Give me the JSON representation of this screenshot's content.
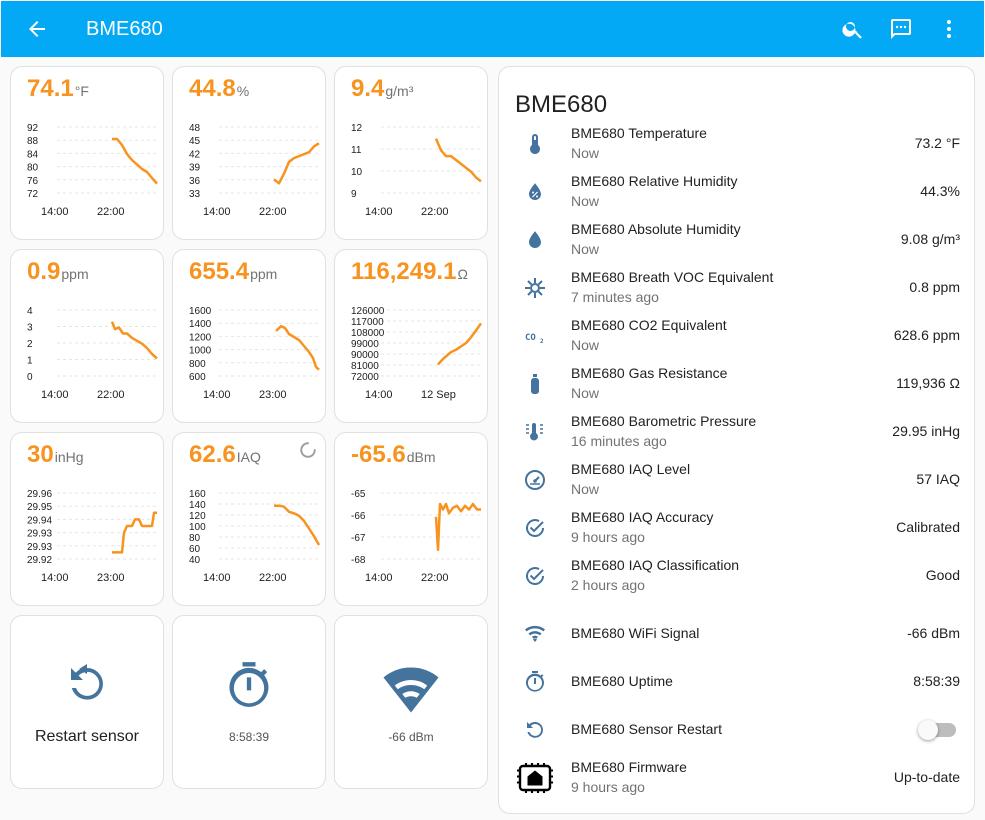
{
  "header": {
    "title": "BME680"
  },
  "colors": {
    "accent": "#f7931e",
    "primary": "#03a9f4",
    "icon": "#44739e"
  },
  "sensor_cards": [
    {
      "value": "74.1",
      "unit": "°F",
      "chart_data": {
        "type": "line",
        "yticks": [
          "92",
          "88",
          "84",
          "80",
          "76",
          "72"
        ],
        "xticks": [
          "14:00",
          "22:00"
        ],
        "ylim": [
          71,
          93
        ],
        "points": [
          [
            0.55,
            89
          ],
          [
            0.6,
            89
          ],
          [
            0.65,
            87
          ],
          [
            0.7,
            84
          ],
          [
            0.75,
            82
          ],
          [
            0.8,
            80.5
          ],
          [
            0.85,
            79
          ],
          [
            0.9,
            78
          ],
          [
            0.95,
            76
          ],
          [
            1.0,
            74.1
          ]
        ]
      }
    },
    {
      "value": "44.8",
      "unit": "%",
      "chart_data": {
        "type": "line",
        "yticks": [
          "48",
          "45",
          "42",
          "39",
          "36",
          "33"
        ],
        "xticks": [
          "14:00",
          "22:00"
        ],
        "ylim": [
          32,
          49
        ],
        "points": [
          [
            0.55,
            35.5
          ],
          [
            0.6,
            34.5
          ],
          [
            0.65,
            37
          ],
          [
            0.7,
            40
          ],
          [
            0.75,
            41
          ],
          [
            0.8,
            41.5
          ],
          [
            0.85,
            42
          ],
          [
            0.9,
            42.5
          ],
          [
            0.95,
            44
          ],
          [
            1.0,
            44.8
          ]
        ]
      }
    },
    {
      "value": "9.4",
      "unit": "g/m³",
      "chart_data": {
        "type": "line",
        "yticks": [
          "12",
          "11",
          "10",
          "9"
        ],
        "xticks": [
          "14:00",
          "22:00"
        ],
        "ylim": [
          8.8,
          12.2
        ],
        "points": [
          [
            0.55,
            11.6
          ],
          [
            0.6,
            11.0
          ],
          [
            0.65,
            10.7
          ],
          [
            0.7,
            10.7
          ],
          [
            0.75,
            10.5
          ],
          [
            0.8,
            10.3
          ],
          [
            0.85,
            10.1
          ],
          [
            0.9,
            9.9
          ],
          [
            0.95,
            9.6
          ],
          [
            1.0,
            9.4
          ]
        ]
      }
    },
    {
      "value": "0.9",
      "unit": "ppm",
      "chart_data": {
        "type": "line",
        "yticks": [
          "4",
          "3",
          "2",
          "1",
          "0"
        ],
        "xticks": [
          "14:00",
          "22:00"
        ],
        "ylim": [
          -0.3,
          4.2
        ],
        "points": [
          [
            0.55,
            3.4
          ],
          [
            0.58,
            2.9
          ],
          [
            0.62,
            3.0
          ],
          [
            0.66,
            2.6
          ],
          [
            0.7,
            2.6
          ],
          [
            0.75,
            2.3
          ],
          [
            0.8,
            2.1
          ],
          [
            0.85,
            1.9
          ],
          [
            0.9,
            1.6
          ],
          [
            0.95,
            1.2
          ],
          [
            1.0,
            0.9
          ]
        ]
      }
    },
    {
      "value": "655.4",
      "unit": "ppm",
      "chart_data": {
        "type": "line",
        "yticks": [
          "1600",
          "1400",
          "1200",
          "1000",
          "800",
          "600"
        ],
        "xticks": [
          "14:00",
          "23:00"
        ],
        "ylim": [
          550,
          1650
        ],
        "points": [
          [
            0.57,
            1300
          ],
          [
            0.62,
            1380
          ],
          [
            0.66,
            1350
          ],
          [
            0.7,
            1250
          ],
          [
            0.75,
            1200
          ],
          [
            0.8,
            1150
          ],
          [
            0.85,
            1050
          ],
          [
            0.9,
            950
          ],
          [
            0.94,
            850
          ],
          [
            0.97,
            700
          ],
          [
            1.0,
            655
          ]
        ]
      }
    },
    {
      "value": "116,249.1",
      "unit": "Ω",
      "chart_data": {
        "type": "line",
        "yticks": [
          "126000",
          "117000",
          "108000",
          "99000",
          "90000",
          "81000",
          "72000"
        ],
        "xticks": [
          "14:00",
          "12 Sep"
        ],
        "ylim": [
          70000,
          128000
        ],
        "points": [
          [
            0.57,
            80000
          ],
          [
            0.62,
            85000
          ],
          [
            0.66,
            88000
          ],
          [
            0.7,
            91000
          ],
          [
            0.75,
            93000
          ],
          [
            0.8,
            96000
          ],
          [
            0.85,
            99000
          ],
          [
            0.9,
            104000
          ],
          [
            0.95,
            110000
          ],
          [
            1.0,
            116249
          ]
        ]
      }
    },
    {
      "value": "30",
      "unit": "inHg",
      "chart_data": {
        "type": "line",
        "yticks": [
          "29.96",
          "29.95",
          "29.94",
          "29.93",
          "29.93",
          "29.92"
        ],
        "xticks": [
          "14:00",
          "23:00"
        ],
        "ylim": [
          29.915,
          29.965
        ],
        "points": [
          [
            0.55,
            29.92
          ],
          [
            0.6,
            29.92
          ],
          [
            0.65,
            29.92
          ],
          [
            0.67,
            29.935
          ],
          [
            0.7,
            29.94
          ],
          [
            0.75,
            29.94
          ],
          [
            0.78,
            29.945
          ],
          [
            0.82,
            29.945
          ],
          [
            0.85,
            29.94
          ],
          [
            0.9,
            29.94
          ],
          [
            0.95,
            29.94
          ],
          [
            0.97,
            29.95
          ],
          [
            1.0,
            29.95
          ]
        ]
      }
    },
    {
      "value": "62.6",
      "unit": "IAQ",
      "spinner": true,
      "chart_data": {
        "type": "line",
        "yticks": [
          "160",
          "140",
          "120",
          "100",
          "80",
          "60",
          "40"
        ],
        "xticks": [
          "14:00",
          "22:00"
        ],
        "ylim": [
          35,
          165
        ],
        "points": [
          [
            0.55,
            140
          ],
          [
            0.6,
            140
          ],
          [
            0.65,
            138
          ],
          [
            0.7,
            128
          ],
          [
            0.75,
            125
          ],
          [
            0.8,
            120
          ],
          [
            0.85,
            110
          ],
          [
            0.9,
            95
          ],
          [
            0.95,
            80
          ],
          [
            1.0,
            62.6
          ]
        ]
      }
    },
    {
      "value": "-65.6",
      "unit": "dBm",
      "chart_data": {
        "type": "line",
        "yticks": [
          "-65",
          "-66",
          "-67",
          "-68"
        ],
        "xticks": [
          "14:00",
          "22:00"
        ],
        "ylim": [
          -68.3,
          -64.7
        ],
        "points": [
          [
            0.55,
            -66
          ],
          [
            0.57,
            -67.8
          ],
          [
            0.59,
            -65.3
          ],
          [
            0.62,
            -65.6
          ],
          [
            0.65,
            -65.3
          ],
          [
            0.68,
            -65.8
          ],
          [
            0.72,
            -65.5
          ],
          [
            0.76,
            -65.4
          ],
          [
            0.8,
            -65.7
          ],
          [
            0.84,
            -65.4
          ],
          [
            0.88,
            -65.6
          ],
          [
            0.92,
            -65.3
          ],
          [
            0.96,
            -65.6
          ],
          [
            1.0,
            -65.6
          ]
        ]
      }
    }
  ],
  "button_cards": [
    {
      "label": "Restart sensor",
      "icon": "restart-icon"
    },
    {
      "label": "8:58:39",
      "icon": "timer-icon"
    },
    {
      "label": "-66 dBm",
      "icon": "wifi-icon"
    }
  ],
  "entities": {
    "title": "BME680",
    "rows": [
      {
        "name": "BME680 Temperature",
        "secondary": "Now",
        "value": "73.2 °F",
        "icon": "thermometer-icon"
      },
      {
        "name": "BME680 Relative Humidity",
        "secondary": "Now",
        "value": "44.3%",
        "icon": "water-percent-icon"
      },
      {
        "name": "BME680 Absolute Humidity",
        "secondary": "Now",
        "value": "9.08 g/m³",
        "icon": "water-drop-icon"
      },
      {
        "name": "BME680 Breath VOC Equivalent",
        "secondary": "7 minutes ago",
        "value": "0.8 ppm",
        "icon": "virus-icon"
      },
      {
        "name": "BME680 CO2 Equivalent",
        "secondary": "Now",
        "value": "628.6 ppm",
        "icon": "co2-icon"
      },
      {
        "name": "BME680 Gas Resistance",
        "secondary": "Now",
        "value": "119,936 Ω",
        "icon": "gas-cylinder-icon"
      },
      {
        "name": "BME680 Barometric Pressure",
        "secondary": "16 minutes ago",
        "value": "29.95 inHg",
        "icon": "thermometer-lines-icon"
      },
      {
        "name": "BME680 IAQ Level",
        "secondary": "Now",
        "value": "57 IAQ",
        "icon": "gauge-icon"
      },
      {
        "name": "BME680 IAQ Accuracy",
        "secondary": "9 hours ago",
        "value": "Calibrated",
        "icon": "check-circle-icon"
      },
      {
        "name": "BME680 IAQ Classification",
        "secondary": "2 hours ago",
        "value": "Good",
        "icon": "check-circle-icon"
      },
      {
        "name": "BME680 WiFi Signal",
        "secondary": "",
        "value": "-66 dBm",
        "icon": "wifi-icon"
      },
      {
        "name": "BME680 Uptime",
        "secondary": "",
        "value": "8:58:39",
        "icon": "timer-icon"
      },
      {
        "name": "BME680 Sensor Restart",
        "secondary": "",
        "value": "",
        "toggle": "off",
        "icon": "restart-icon"
      },
      {
        "name": "BME680 Firmware",
        "secondary": "9 hours ago",
        "value": "Up-to-date",
        "icon": "firmware-icon"
      }
    ]
  }
}
